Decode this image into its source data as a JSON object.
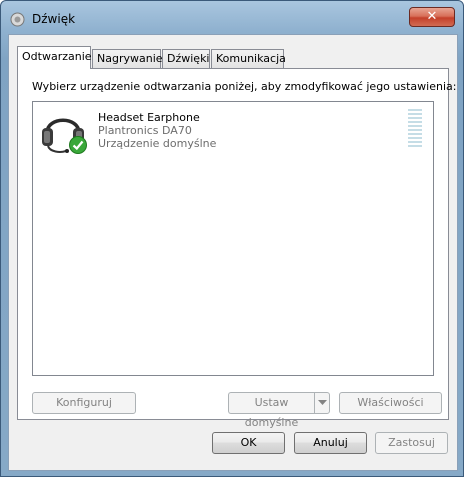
{
  "window": {
    "title": "Dźwięk",
    "close_label": "✕"
  },
  "tabs": [
    {
      "label": "Odtwarzanie",
      "active": true
    },
    {
      "label": "Nagrywanie",
      "active": false
    },
    {
      "label": "Dźwięki",
      "active": false
    },
    {
      "label": "Komunikacja",
      "active": false
    }
  ],
  "panel": {
    "instruction": "Wybierz urządzenie odtwarzania poniżej, aby zmodyfikować jego ustawienia:",
    "devices": [
      {
        "name": "Headset Earphone",
        "model": "Plantronics DA70",
        "status": "Urządzenie domyślne",
        "icon": "headset-icon",
        "default_badge": "check-icon"
      }
    ],
    "configure_label": "Konfiguruj",
    "set_default_label": "Ustaw domyślne",
    "properties_label": "Właściwości"
  },
  "footer": {
    "ok_label": "OK",
    "cancel_label": "Anuluj",
    "apply_label": "Zastosuj"
  },
  "colors": {
    "accent_check": "#3aa83a",
    "meter": "#c5dde6",
    "title_close": "#c4402a"
  }
}
